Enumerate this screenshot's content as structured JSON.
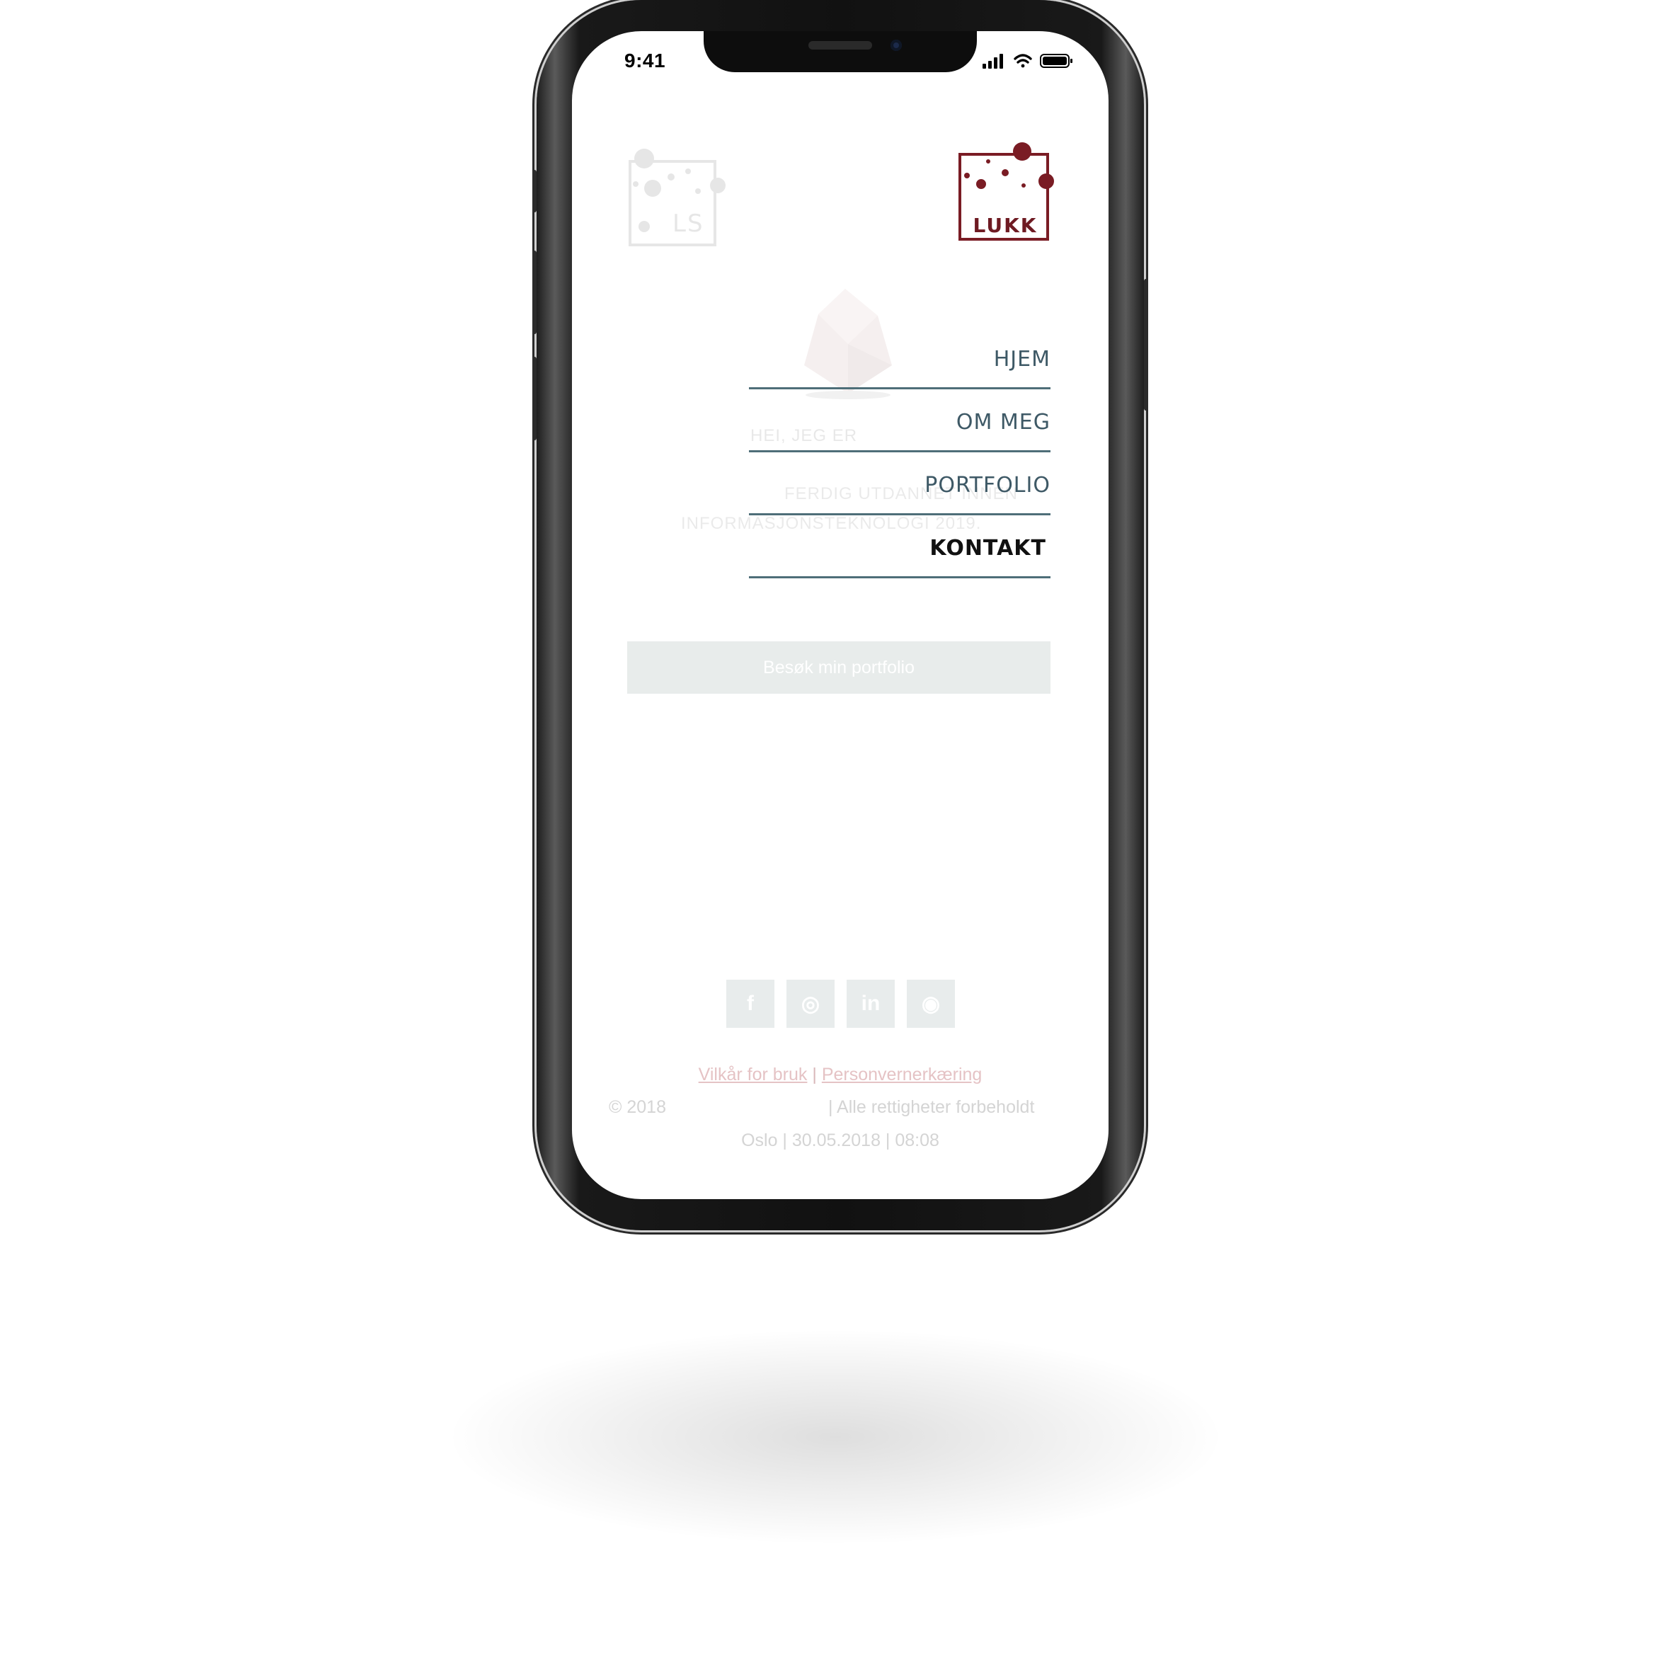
{
  "status_bar": {
    "time": "9:41"
  },
  "background_page": {
    "logo_text": "LS",
    "greeting": "HEI, JEG ER",
    "subtitle_line1": "FERDIG UTDANNET INNEN",
    "subtitle_line2": "INFORMASJONSTEKNOLOGI 2019.",
    "cta_label": "Besøk min portfolio",
    "socials": [
      {
        "icon": "facebook-icon",
        "glyph": "f"
      },
      {
        "icon": "instagram-icon",
        "glyph": "◎"
      },
      {
        "icon": "linkedin-icon",
        "glyph": "in"
      },
      {
        "icon": "github-icon",
        "glyph": "◉"
      }
    ],
    "footer": {
      "terms": "Vilkår for bruk",
      "separator": "|",
      "privacy": "Personvernerkæring",
      "copyright": "© 2018",
      "rights": "| Alle rettigheter forbeholdt",
      "dateline": "Oslo | 30.05.2018 | 08:08"
    }
  },
  "menu": {
    "close_label": "LUKK",
    "items": [
      {
        "label": "HJEM"
      },
      {
        "label": "OM MEG"
      },
      {
        "label": "PORTFOLIO"
      },
      {
        "label": "KONTAKT",
        "active": true
      }
    ]
  },
  "colors": {
    "brand": "#7a1c24",
    "menu_text": "#3e5966",
    "menu_active": "#111111",
    "divider": "#4e6e78"
  }
}
